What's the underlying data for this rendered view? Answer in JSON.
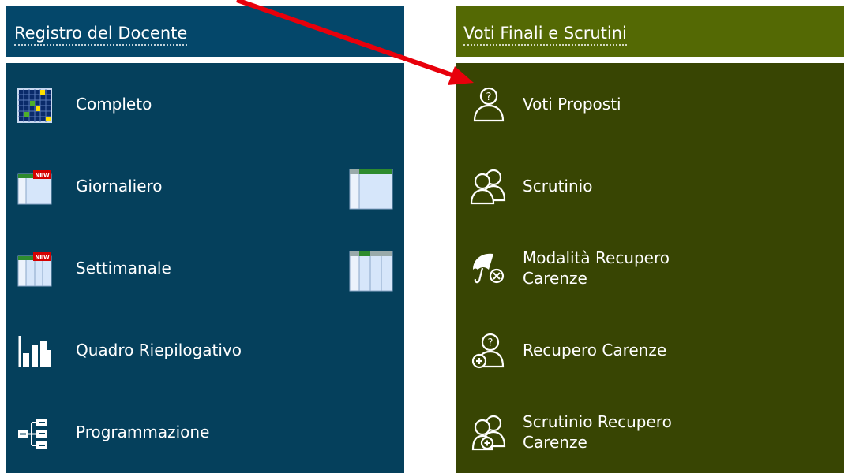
{
  "left_panel": {
    "title": "Registro del Docente",
    "items": [
      {
        "label": "Completo",
        "icon": "grid-calendar-icon"
      },
      {
        "label": "Giornaliero",
        "icon": "daily-register-new-icon",
        "badge": "NEW",
        "secondary_icon": "daily-register-icon"
      },
      {
        "label": "Settimanale",
        "icon": "weekly-register-new-icon",
        "badge": "NEW",
        "secondary_icon": "weekly-register-icon"
      },
      {
        "label": "Quadro Riepilogativo",
        "icon": "bar-chart-icon"
      },
      {
        "label": "Programmazione",
        "icon": "hierarchy-icon"
      }
    ]
  },
  "right_panel": {
    "title": "Voti Finali e Scrutini",
    "items": [
      {
        "label": "Voti Proposti",
        "icon": "person-question-icon"
      },
      {
        "label": "Scrutinio",
        "icon": "people-icon"
      },
      {
        "label": "Modalità Recupero Carenze",
        "icon": "umbrella-cancel-icon"
      },
      {
        "label": "Recupero Carenze",
        "icon": "person-add-icon"
      },
      {
        "label": "Scrutinio Recupero Carenze",
        "icon": "people-add-icon"
      }
    ]
  },
  "annotation": {
    "icon": "red-arrow-icon",
    "color": "#e8000b"
  },
  "colors": {
    "left_header": "#04476a",
    "left_body": "#05405c",
    "right_header": "#546904",
    "right_body": "#384503"
  }
}
